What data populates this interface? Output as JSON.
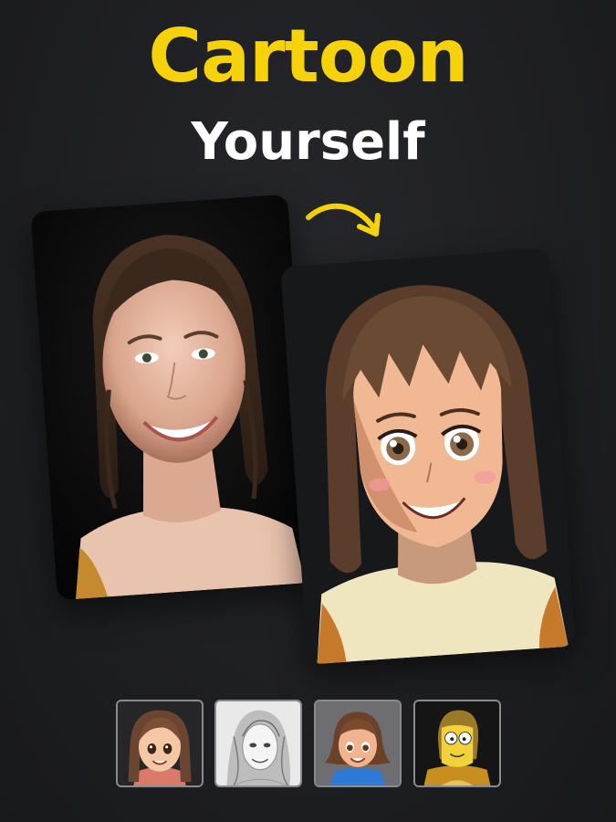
{
  "header": {
    "title_line1": "Cartoon",
    "title_line2": "Yourself"
  },
  "colors": {
    "accent": "#f6d20a",
    "background": "#1d1e21",
    "title_secondary": "#ffffff"
  },
  "icons": {
    "transform_arrow": "curved-arrow-right-icon"
  },
  "cards": {
    "original": "original-photo",
    "result": "cartoon-result"
  },
  "styles": [
    {
      "name": "anime-style"
    },
    {
      "name": "pencil-sketch-style"
    },
    {
      "name": "3d-cartoon-style"
    },
    {
      "name": "yellow-comic-style"
    }
  ]
}
